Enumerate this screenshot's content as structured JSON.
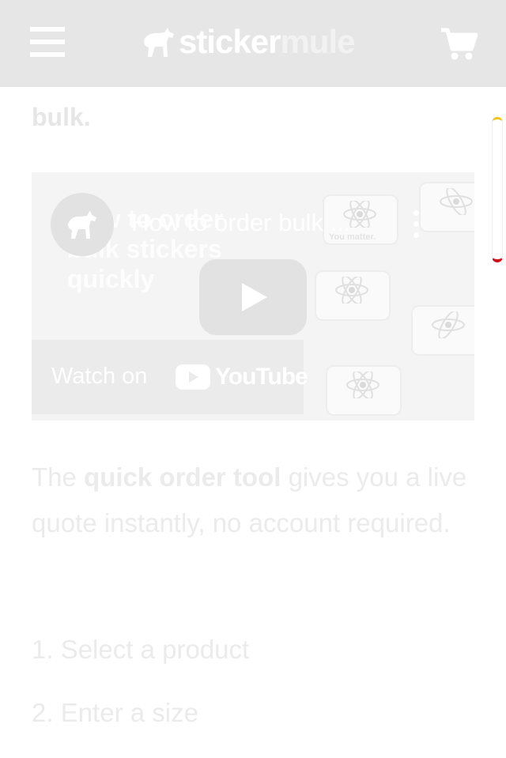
{
  "header": {
    "logo_part1": "sticker",
    "logo_part2": "mule",
    "menu_icon": "hamburger-menu-icon",
    "cart_icon": "shopping-cart-icon"
  },
  "article": {
    "heading_fragment": "bulk.",
    "video": {
      "title": "How to order bulk ...",
      "background_text": [
        "How to order",
        "bulk stickers",
        "quickly"
      ],
      "sticker_label": "You matter.",
      "watch_on_label": "Watch on",
      "youtube_label": "YouTube"
    },
    "paragraph": {
      "before": "The ",
      "bold": "quick order tool",
      "after": " gives you a live quote instantly, no account required."
    },
    "steps": [
      "1. Select a product",
      "2. Enter a size"
    ]
  },
  "colors": {
    "header_bg": "#e6e6e6",
    "scrollbar_top": "#f0c419",
    "scrollbar_bottom": "#d0101a",
    "faded_text": "#ebebeb"
  }
}
